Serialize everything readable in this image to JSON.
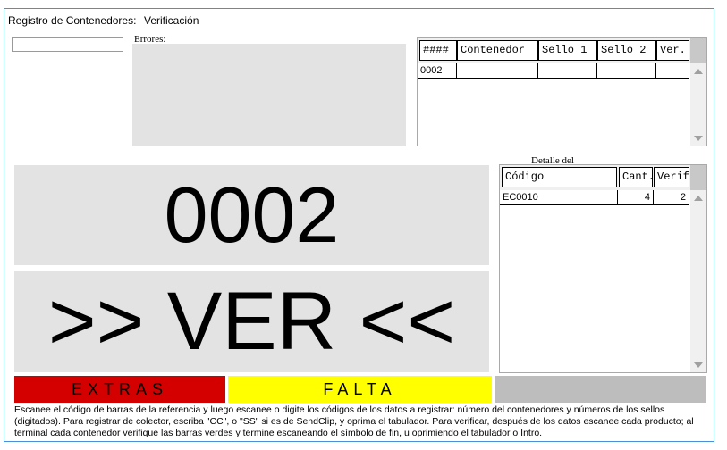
{
  "header": {
    "title": "Registro de Contenedores:",
    "mode": "Verificación"
  },
  "scan": {
    "value": ""
  },
  "errors": {
    "label": "Errores:",
    "text": ""
  },
  "containers_table": {
    "columns": [
      "####",
      "Contenedor",
      "Sello 1",
      "Sello 2",
      "Ver."
    ],
    "rows": [
      [
        "0002",
        "",
        "",
        "",
        ""
      ]
    ]
  },
  "detail": {
    "label": "Detalle del",
    "columns": [
      "Código",
      "Cant.",
      "Verif."
    ],
    "rows": [
      [
        "EC0010",
        "4",
        "2"
      ]
    ]
  },
  "display": {
    "number": "0002",
    "status": ">> VER <<"
  },
  "bars": {
    "extras": "EXTRAS",
    "falta": "FALTA",
    "third": ""
  },
  "colors": {
    "extras": "#d40000",
    "falta": "#ffff00",
    "third": "#bdbdbd",
    "panel": "#e3e3e3"
  },
  "instructions": "Escanee el código de barras de la referencia y luego escanee o digite los códigos de los datos a registrar: número del contenedores y números de los sellos (digitados). Para registrar de colector, escriba \"CC\", o \"SS\" si es de SendClip, y oprima el tabulador. Para verificar, después de los datos escanee cada producto; al terminal cada contenedor verifique las barras verdes y termine escaneando el símbolo de fin, u oprimiendo el tabulador o Intro."
}
